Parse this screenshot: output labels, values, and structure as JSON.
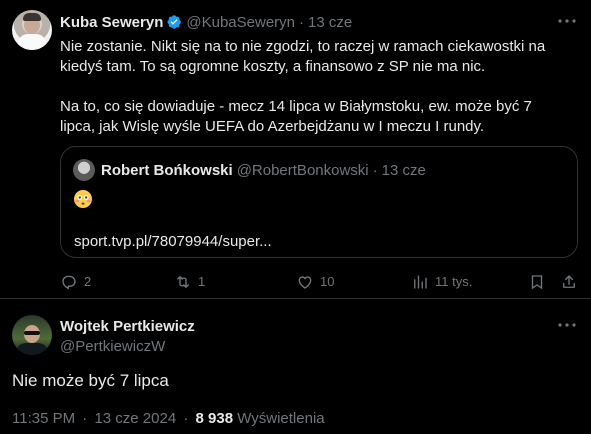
{
  "tweet1": {
    "author_name": "Kuba Seweryn",
    "handle": "@KubaSeweryn",
    "sep": "·",
    "time": "13 cze",
    "lines_para1": [
      "Nie zostanie. Nikt się na to nie zgodzi, to raczej w ramach ciekawostki na",
      "kiedyś tam. To są ogromne koszty, a finansowo z SP nie ma nic."
    ],
    "lines_para2": [
      "Na to, co się dowiaduje - mecz 14 lipca w Białymstoku, ew. może być 7",
      "lipca, jak Wislę wyśle UEFA do Azerbejdżanu w I meczu I rundy."
    ],
    "quote": {
      "author_name": "Robert Bońkowski",
      "handle": "@RobertBonkowski",
      "sep": "·",
      "time": "13 cze",
      "emoji": "😳",
      "link": "sport.tvp.pl/78079944/super..."
    },
    "actions": {
      "replies": "2",
      "retweets": "1",
      "likes": "10",
      "views": "11 tys."
    }
  },
  "tweet2": {
    "author_name": "Wojtek Pertkiewicz",
    "handle": "@PertkiewiczW",
    "text": "Nie może być 7 lipca",
    "time": "11:35 PM",
    "sep1": "·",
    "date": "13 cze 2024",
    "sep2": "·",
    "views_count": "8 938",
    "views_label": "Wyświetlenia"
  },
  "colors": {
    "background": "#000000",
    "text": "#e7e9ea",
    "muted": "#71767b",
    "border": "#2f3336",
    "verified": "#1d9bf0"
  }
}
